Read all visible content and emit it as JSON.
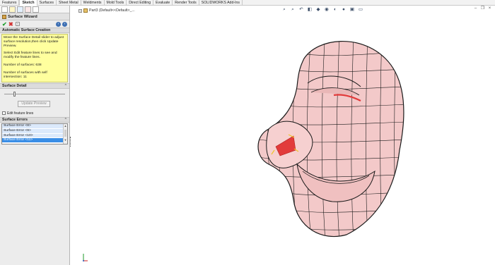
{
  "command_tabs": [
    "Features",
    "Sketch",
    "Surfaces",
    "Sheet Metal",
    "Weldments",
    "Mold Tools",
    "Direct Editing",
    "Evaluate",
    "Render Tools",
    "SOLIDWORKS Add-Ins"
  ],
  "active_tab_index": 1,
  "property_manager": {
    "title": "Surface Wizard",
    "ok_icon": "check-icon",
    "cancel_icon": "x-icon",
    "help_icon": "question-icon",
    "auto_section": {
      "heading": "Automatic Surface Creation",
      "message_p1": "Move the Surface Detail slider to adjust surface resolution,then click Update Preview.",
      "message_p2": "Select Edit feature lines to see and modify the feature lines.",
      "message_p3": "Number of surfaces: 638",
      "message_p4": "Number of surfaces with self intersection: 11"
    },
    "detail_section": {
      "heading": "Surface Detail",
      "slider_level": 0.2,
      "update_button": "Update Preview",
      "edit_lines_label": "Edit feature lines",
      "edit_lines_checked": false
    },
    "errors_section": {
      "heading": "Surface Errors",
      "items": [
        "Surface Error <8>",
        "Surface Error <9>",
        "Surface Error <10>",
        "Surface Error <11>"
      ],
      "selected_index": 3
    }
  },
  "viewport": {
    "tree_item": "Part3  (Default<<Default>_...",
    "heads_up_icons": [
      "zoom-fit-icon",
      "zoom-area-icon",
      "previous-view-icon",
      "section-view-icon",
      "view-orientation-icon",
      "display-style-icon",
      "hide-show-icon",
      "edit-appearance-icon",
      "apply-scene-icon",
      "view-settings-icon"
    ],
    "colors": {
      "mesh_fill": "#f3c9c9",
      "mesh_line": "#1a1a1a",
      "error_fill": "#e23b3b",
      "error_mark": "#f0c428"
    }
  }
}
